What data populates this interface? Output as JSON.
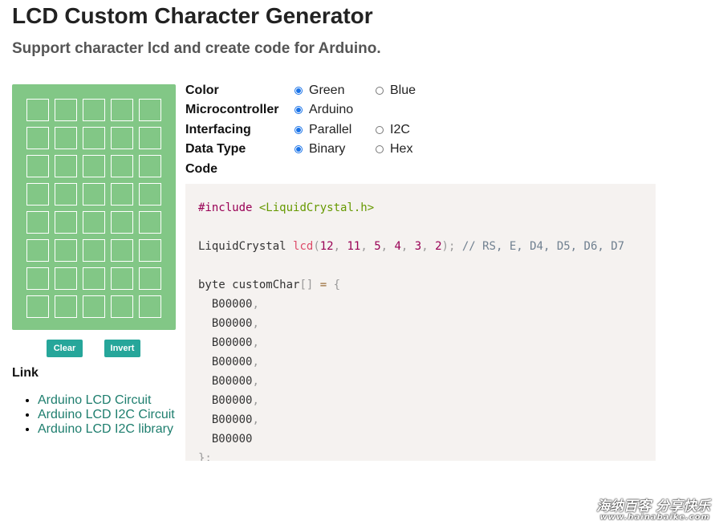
{
  "header": {
    "title": "LCD Custom Character Generator",
    "subtitle": "Support character lcd and create code for Arduino."
  },
  "lcd": {
    "color": "#82c786",
    "rows": [
      [
        0,
        0,
        0,
        0,
        0
      ],
      [
        0,
        0,
        0,
        0,
        0
      ],
      [
        0,
        0,
        0,
        0,
        0
      ],
      [
        0,
        0,
        0,
        0,
        0
      ],
      [
        0,
        0,
        0,
        0,
        0
      ],
      [
        0,
        0,
        0,
        0,
        0
      ],
      [
        0,
        0,
        0,
        0,
        0
      ],
      [
        0,
        0,
        0,
        0,
        0
      ]
    ]
  },
  "buttons": {
    "clear": "Clear",
    "invert": "Invert",
    "color": "#26a69a"
  },
  "links": {
    "heading": "Link",
    "items": [
      "Arduino LCD Circuit",
      "Arduino LCD I2C Circuit",
      "Arduino LCD I2C library"
    ]
  },
  "options": {
    "color": {
      "label": "Color",
      "choices": [
        "Green",
        "Blue"
      ],
      "selected": "Green"
    },
    "microcontroller": {
      "label": "Microcontroller",
      "choices": [
        "Arduino"
      ],
      "selected": "Arduino"
    },
    "interfacing": {
      "label": "Interfacing",
      "choices": [
        "Parallel",
        "I2C"
      ],
      "selected": "Parallel"
    },
    "data_type": {
      "label": "Data Type",
      "choices": [
        "Binary",
        "Hex"
      ],
      "selected": "Binary"
    },
    "code_label": "Code"
  },
  "code": {
    "include_directive": "#include",
    "include_file": "<LiquidCrystal.h>",
    "class_name": "LiquidCrystal",
    "instance": "lcd",
    "pins": [
      "12",
      "11",
      "5",
      "4",
      "3",
      "2"
    ],
    "comment": "// RS, E, D4, D5, D6, D7",
    "array_decl": "byte customChar",
    "bytes": [
      "B00000",
      "B00000",
      "B00000",
      "B00000",
      "B00000",
      "B00000",
      "B00000",
      "B00000"
    ]
  },
  "watermark": {
    "line1": "海纳百客 分享快乐",
    "line2": "www.hainabaike.com"
  }
}
